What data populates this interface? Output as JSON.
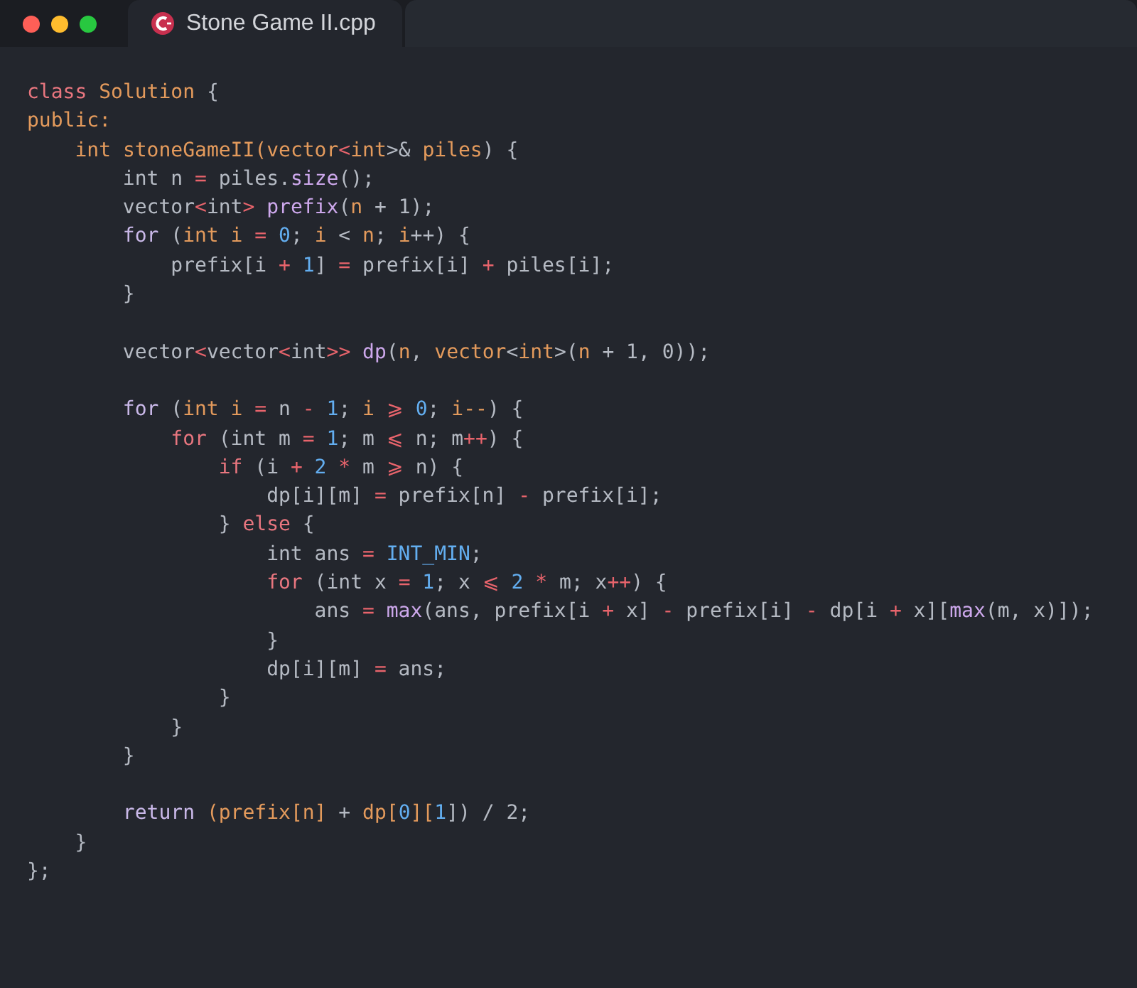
{
  "tab": {
    "title": "Stone Game II.cpp"
  },
  "lines": [
    {
      "kind": "code",
      "tokens": [
        {
          "text": "class",
          "kind": "kw"
        },
        {
          "text": " Solution",
          "kind": "ty"
        },
        {
          "text": " {",
          "kind": "pl"
        }
      ]
    },
    {
      "kind": "code",
      "tokens": [
        {
          "text": "public:",
          "kind": "ty"
        }
      ]
    },
    {
      "kind": "code",
      "tokens": [
        {
          "text": "    int",
          "kind": "ty"
        },
        {
          "text": " stoneGameII(vector",
          "kind": "ty"
        },
        {
          "text": "<",
          "kind": "op"
        },
        {
          "text": "int",
          "kind": "ty"
        },
        {
          "text": ">& ",
          "kind": "pl"
        },
        {
          "text": "piles",
          "kind": "ty"
        },
        {
          "text": ") {",
          "kind": "pl"
        }
      ]
    },
    {
      "kind": "code",
      "tokens": [
        {
          "text": "        int n ",
          "kind": "pl"
        },
        {
          "text": "=",
          "kind": "op"
        },
        {
          "text": " piles.",
          "kind": "pl"
        },
        {
          "text": "size",
          "kind": "fn"
        },
        {
          "text": "();",
          "kind": "pl"
        }
      ]
    },
    {
      "kind": "code",
      "tokens": [
        {
          "text": "        vector",
          "kind": "pl"
        },
        {
          "text": "<",
          "kind": "op"
        },
        {
          "text": "int",
          "kind": "pl"
        },
        {
          "text": ">",
          "kind": "op"
        },
        {
          "text": " prefix",
          "kind": "fn"
        },
        {
          "text": "(",
          "kind": "pl"
        },
        {
          "text": "n",
          "kind": "ty"
        },
        {
          "text": " + 1);",
          "kind": "pl"
        }
      ]
    },
    {
      "kind": "code",
      "tokens": [
        {
          "text": "        for",
          "kind": "ctl"
        },
        {
          "text": " (",
          "kind": "pl"
        },
        {
          "text": "int i",
          "kind": "ty"
        },
        {
          "text": " =",
          "kind": "op"
        },
        {
          "text": " 0",
          "kind": "num"
        },
        {
          "text": "; ",
          "kind": "pl"
        },
        {
          "text": "i",
          "kind": "ty"
        },
        {
          "text": " < ",
          "kind": "pl"
        },
        {
          "text": "n",
          "kind": "ty"
        },
        {
          "text": "; ",
          "kind": "pl"
        },
        {
          "text": "i",
          "kind": "ty"
        },
        {
          "text": "++) {",
          "kind": "pl"
        }
      ]
    },
    {
      "kind": "code",
      "tokens": [
        {
          "text": "            prefix[i ",
          "kind": "pl"
        },
        {
          "text": "+",
          "kind": "op"
        },
        {
          "text": " 1",
          "kind": "num"
        },
        {
          "text": "] ",
          "kind": "pl"
        },
        {
          "text": "=",
          "kind": "op"
        },
        {
          "text": " prefix[i] ",
          "kind": "pl"
        },
        {
          "text": "+",
          "kind": "op"
        },
        {
          "text": " piles[i];",
          "kind": "pl"
        }
      ]
    },
    {
      "kind": "code",
      "tokens": [
        {
          "text": "        }",
          "kind": "pl"
        }
      ]
    },
    {
      "kind": "blank"
    },
    {
      "kind": "code",
      "tokens": [
        {
          "text": "        vector",
          "kind": "pl"
        },
        {
          "text": "<",
          "kind": "op"
        },
        {
          "text": "vector",
          "kind": "pl"
        },
        {
          "text": "<",
          "kind": "op"
        },
        {
          "text": "int",
          "kind": "pl"
        },
        {
          "text": ">>",
          "kind": "op"
        },
        {
          "text": " dp",
          "kind": "fn"
        },
        {
          "text": "(",
          "kind": "pl"
        },
        {
          "text": "n",
          "kind": "ty"
        },
        {
          "text": ", ",
          "kind": "pl"
        },
        {
          "text": "vector",
          "kind": "ty"
        },
        {
          "text": "<",
          "kind": "pl"
        },
        {
          "text": "int",
          "kind": "ty"
        },
        {
          "text": ">(",
          "kind": "pl"
        },
        {
          "text": "n",
          "kind": "ty"
        },
        {
          "text": " + 1, 0));",
          "kind": "pl"
        }
      ]
    },
    {
      "kind": "blank"
    },
    {
      "kind": "code",
      "tokens": [
        {
          "text": "        for",
          "kind": "ctl"
        },
        {
          "text": " (",
          "kind": "pl"
        },
        {
          "text": "int i",
          "kind": "ty"
        },
        {
          "text": " =",
          "kind": "op"
        },
        {
          "text": " n ",
          "kind": "pl"
        },
        {
          "text": "-",
          "kind": "op"
        },
        {
          "text": " 1",
          "kind": "num"
        },
        {
          "text": "; ",
          "kind": "pl"
        },
        {
          "text": "i",
          "kind": "ty"
        },
        {
          "text": " ⩾",
          "kind": "op"
        },
        {
          "text": " 0",
          "kind": "num"
        },
        {
          "text": "; ",
          "kind": "pl"
        },
        {
          "text": "i--",
          "kind": "ty"
        },
        {
          "text": ") {",
          "kind": "pl"
        }
      ]
    },
    {
      "kind": "code",
      "tokens": [
        {
          "text": "            for",
          "kind": "kw"
        },
        {
          "text": " (int m ",
          "kind": "pl"
        },
        {
          "text": "=",
          "kind": "op"
        },
        {
          "text": " 1",
          "kind": "num"
        },
        {
          "text": "; m ",
          "kind": "pl"
        },
        {
          "text": "⩽",
          "kind": "op"
        },
        {
          "text": " n; m",
          "kind": "pl"
        },
        {
          "text": "++",
          "kind": "op"
        },
        {
          "text": ") {",
          "kind": "pl"
        }
      ]
    },
    {
      "kind": "code",
      "tokens": [
        {
          "text": "                if",
          "kind": "kw"
        },
        {
          "text": " (i ",
          "kind": "pl"
        },
        {
          "text": "+",
          "kind": "op"
        },
        {
          "text": " 2",
          "kind": "num"
        },
        {
          "text": " *",
          "kind": "op"
        },
        {
          "text": " m ",
          "kind": "pl"
        },
        {
          "text": "⩾",
          "kind": "op"
        },
        {
          "text": " n) {",
          "kind": "pl"
        }
      ]
    },
    {
      "kind": "code",
      "tokens": [
        {
          "text": "                    dp[i][m] ",
          "kind": "pl"
        },
        {
          "text": "=",
          "kind": "op"
        },
        {
          "text": " prefix[n] ",
          "kind": "pl"
        },
        {
          "text": "-",
          "kind": "op"
        },
        {
          "text": " prefix[i];",
          "kind": "pl"
        }
      ]
    },
    {
      "kind": "code",
      "tokens": [
        {
          "text": "                } ",
          "kind": "pl"
        },
        {
          "text": "else",
          "kind": "kw"
        },
        {
          "text": " {",
          "kind": "pl"
        }
      ]
    },
    {
      "kind": "code",
      "tokens": [
        {
          "text": "                    int ans ",
          "kind": "pl"
        },
        {
          "text": "=",
          "kind": "op"
        },
        {
          "text": " INT_MIN",
          "kind": "num"
        },
        {
          "text": ";",
          "kind": "pl"
        }
      ]
    },
    {
      "kind": "code",
      "tokens": [
        {
          "text": "                    for",
          "kind": "kw"
        },
        {
          "text": " (int x ",
          "kind": "pl"
        },
        {
          "text": "=",
          "kind": "op"
        },
        {
          "text": " 1",
          "kind": "num"
        },
        {
          "text": "; x ",
          "kind": "pl"
        },
        {
          "text": "⩽",
          "kind": "op"
        },
        {
          "text": " 2",
          "kind": "num"
        },
        {
          "text": " *",
          "kind": "op"
        },
        {
          "text": " m; x",
          "kind": "pl"
        },
        {
          "text": "++",
          "kind": "op"
        },
        {
          "text": ") {",
          "kind": "pl"
        }
      ]
    },
    {
      "kind": "code",
      "tokens": [
        {
          "text": "                        ans ",
          "kind": "pl"
        },
        {
          "text": "=",
          "kind": "op"
        },
        {
          "text": " max",
          "kind": "fn"
        },
        {
          "text": "(ans, prefix[i ",
          "kind": "pl"
        },
        {
          "text": "+",
          "kind": "op"
        },
        {
          "text": " x] ",
          "kind": "pl"
        },
        {
          "text": "-",
          "kind": "op"
        },
        {
          "text": " prefix[i] ",
          "kind": "pl"
        },
        {
          "text": "-",
          "kind": "op"
        },
        {
          "text": " dp[i ",
          "kind": "pl"
        },
        {
          "text": "+",
          "kind": "op"
        },
        {
          "text": " x][",
          "kind": "pl"
        },
        {
          "text": "max",
          "kind": "fn"
        },
        {
          "text": "(m, x)]);",
          "kind": "pl"
        }
      ]
    },
    {
      "kind": "code",
      "tokens": [
        {
          "text": "                    }",
          "kind": "pl"
        }
      ]
    },
    {
      "kind": "code",
      "tokens": [
        {
          "text": "                    dp[i][m] ",
          "kind": "pl"
        },
        {
          "text": "=",
          "kind": "op"
        },
        {
          "text": " ans;",
          "kind": "pl"
        }
      ]
    },
    {
      "kind": "code",
      "tokens": [
        {
          "text": "                }",
          "kind": "pl"
        }
      ]
    },
    {
      "kind": "code",
      "tokens": [
        {
          "text": "            }",
          "kind": "pl"
        }
      ]
    },
    {
      "kind": "code",
      "tokens": [
        {
          "text": "        }",
          "kind": "pl"
        }
      ]
    },
    {
      "kind": "blank"
    },
    {
      "kind": "code",
      "tokens": [
        {
          "text": "        return",
          "kind": "ctl"
        },
        {
          "text": " (prefix[n]",
          "kind": "ty"
        },
        {
          "text": " + ",
          "kind": "pl"
        },
        {
          "text": "dp[",
          "kind": "ty"
        },
        {
          "text": "0",
          "kind": "num"
        },
        {
          "text": "][",
          "kind": "ty"
        },
        {
          "text": "1",
          "kind": "num"
        },
        {
          "text": "]) / 2;",
          "kind": "pl"
        }
      ]
    },
    {
      "kind": "code",
      "tokens": [
        {
          "text": "    }",
          "kind": "pl"
        }
      ]
    },
    {
      "kind": "code",
      "tokens": [
        {
          "text": "};",
          "kind": "pl"
        }
      ]
    }
  ]
}
